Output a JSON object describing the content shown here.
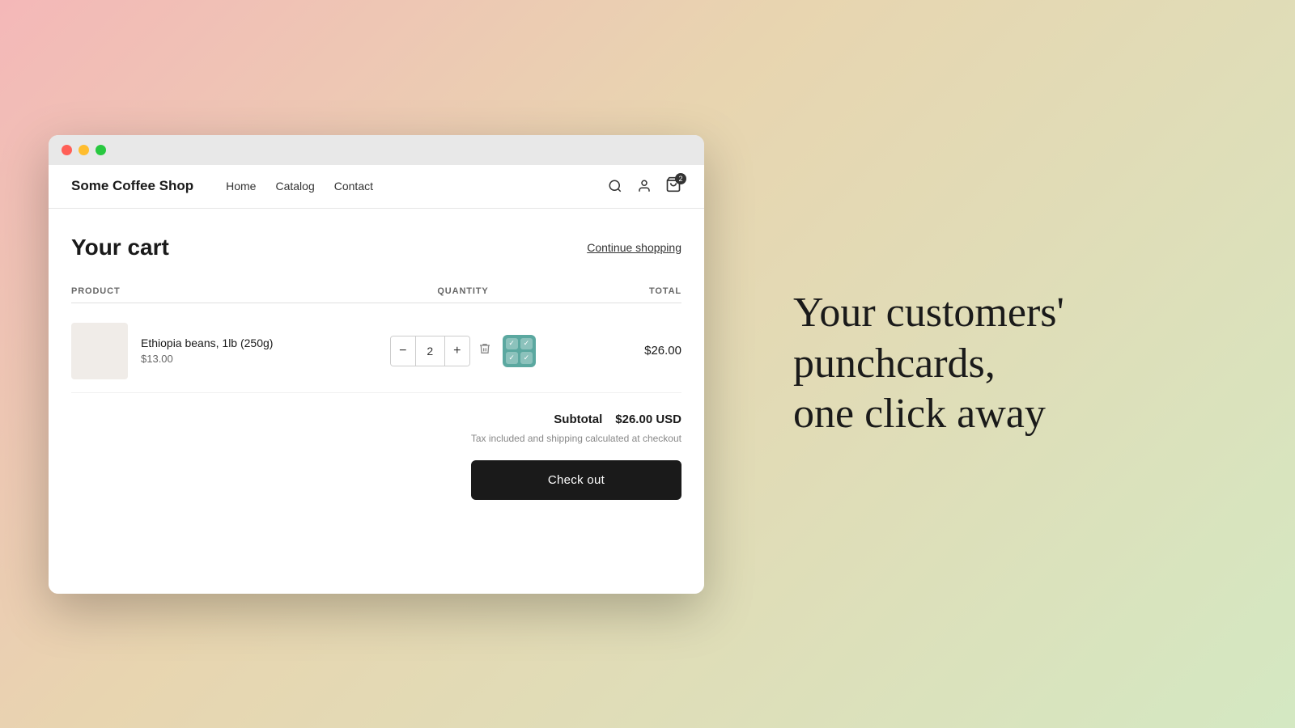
{
  "background": {
    "gradient": "linear-gradient(135deg, #f4b8b8 0%, #e8d5b0 40%, #d4e8c2 100%)"
  },
  "browser": {
    "buttons": {
      "red": "close",
      "yellow": "minimize",
      "green": "maximize"
    }
  },
  "nav": {
    "store_name": "Some Coffee Shop",
    "links": [
      "Home",
      "Catalog",
      "Contact"
    ],
    "cart_count": "2"
  },
  "cart": {
    "title": "Your cart",
    "continue_shopping": "Continue shopping",
    "columns": {
      "product": "PRODUCT",
      "quantity": "QUANTITY",
      "total": "TOTAL"
    },
    "items": [
      {
        "name": "Ethiopia beans, 1lb (250g)",
        "price": "$13.00",
        "quantity": 2,
        "total": "$26.00"
      }
    ],
    "subtotal_label": "Subtotal",
    "subtotal_value": "$26.00 USD",
    "tax_note": "Tax included and shipping calculated at checkout",
    "checkout_label": "Check out"
  },
  "tagline": {
    "line1": "Your customers'",
    "line2": "punchcards,",
    "line3": "one click away"
  }
}
